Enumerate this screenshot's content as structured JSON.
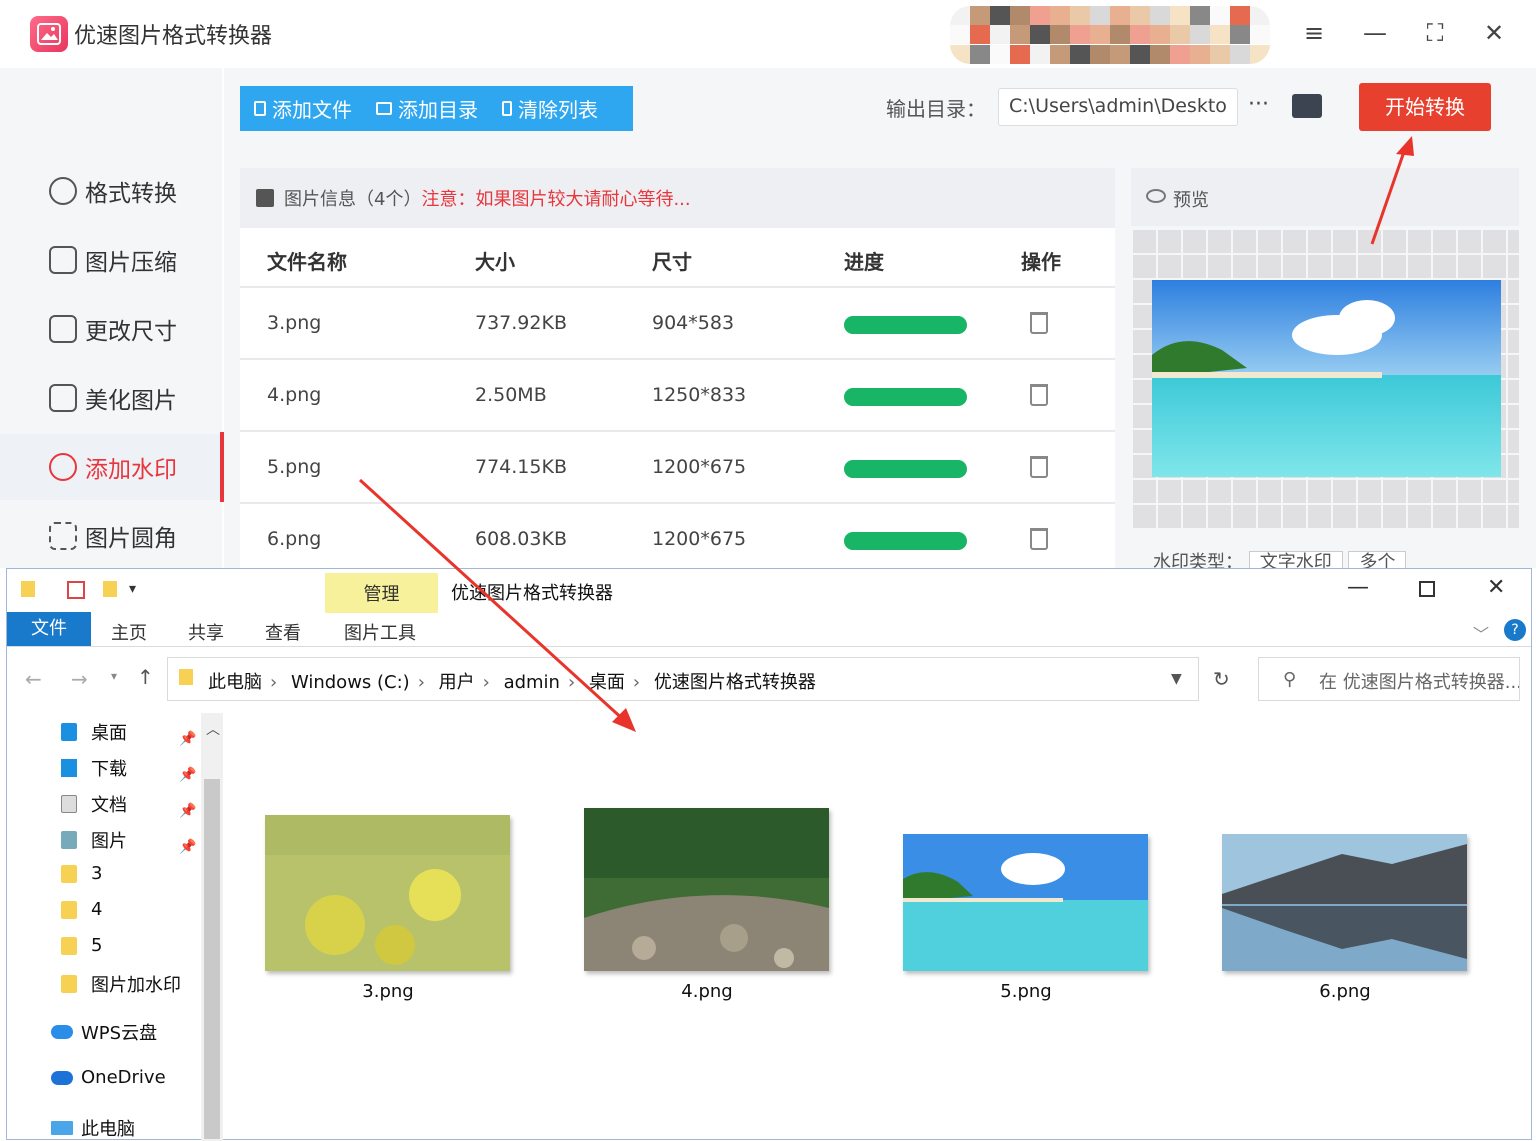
{
  "app": {
    "title": "优速图片格式转换器",
    "window_buttons": {
      "menu": "≡",
      "minimize": "—",
      "maximize": "⛶",
      "close": "✕"
    }
  },
  "sidebar": {
    "items": [
      {
        "label": "格式转换",
        "icon": "format-convert-icon"
      },
      {
        "label": "图片压缩",
        "icon": "compress-icon"
      },
      {
        "label": "更改尺寸",
        "icon": "resize-icon"
      },
      {
        "label": "美化图片",
        "icon": "beautify-icon"
      },
      {
        "label": "添加水印",
        "icon": "watermark-icon",
        "active": true
      },
      {
        "label": "图片圆角",
        "icon": "rounded-corner-icon"
      }
    ]
  },
  "toolbar": {
    "add_file": "添加文件",
    "add_dir": "添加目录",
    "clear_list": "清除列表",
    "output_label": "输出目录：",
    "output_path": "C:\\Users\\admin\\Deskto",
    "more": "···",
    "start": "开始转换"
  },
  "panel": {
    "info": "图片信息（4个）",
    "warning": "注意：如果图片较大请耐心等待...",
    "columns": [
      "文件名称",
      "大小",
      "尺寸",
      "进度",
      "操作"
    ],
    "rows": [
      {
        "name": "3.png",
        "size": "737.92KB",
        "dims": "904*583",
        "progress": 1.0
      },
      {
        "name": "4.png",
        "size": "2.50MB",
        "dims": "1250*833",
        "progress": 1.0
      },
      {
        "name": "5.png",
        "size": "774.15KB",
        "dims": "1200*675",
        "progress": 1.0
      },
      {
        "name": "6.png",
        "size": "608.03KB",
        "dims": "1200*675",
        "progress": 1.0
      }
    ]
  },
  "preview": {
    "label": "预览",
    "watermark_type_label": "水印类型：",
    "watermark_type_value": "文字水印",
    "count_value": "多个"
  },
  "explorer": {
    "manage_tab": "管理",
    "title": "优速图片格式转换器",
    "tabs": [
      "文件",
      "主页",
      "共享",
      "查看",
      "图片工具"
    ],
    "path": [
      "此电脑",
      "Windows (C:)",
      "用户",
      "admin",
      "桌面",
      "优速图片格式转换器"
    ],
    "search_placeholder": "在 优速图片格式转换器...",
    "nav": [
      {
        "label": "桌面",
        "pinned": true
      },
      {
        "label": "下载",
        "pinned": true
      },
      {
        "label": "文档",
        "pinned": true
      },
      {
        "label": "图片",
        "pinned": true
      },
      {
        "label": "3"
      },
      {
        "label": "4"
      },
      {
        "label": "5"
      },
      {
        "label": "图片加水印"
      },
      {
        "label": "WPS云盘"
      },
      {
        "label": "OneDrive"
      },
      {
        "label": "此电脑"
      }
    ],
    "files": [
      "3.png",
      "4.png",
      "5.png",
      "6.png"
    ]
  },
  "colors": {
    "accent_red": "#e8402e",
    "toolbar_blue": "#2fa7f0",
    "progress_green": "#18b566",
    "explorer_file_tab": "#1979ca"
  }
}
